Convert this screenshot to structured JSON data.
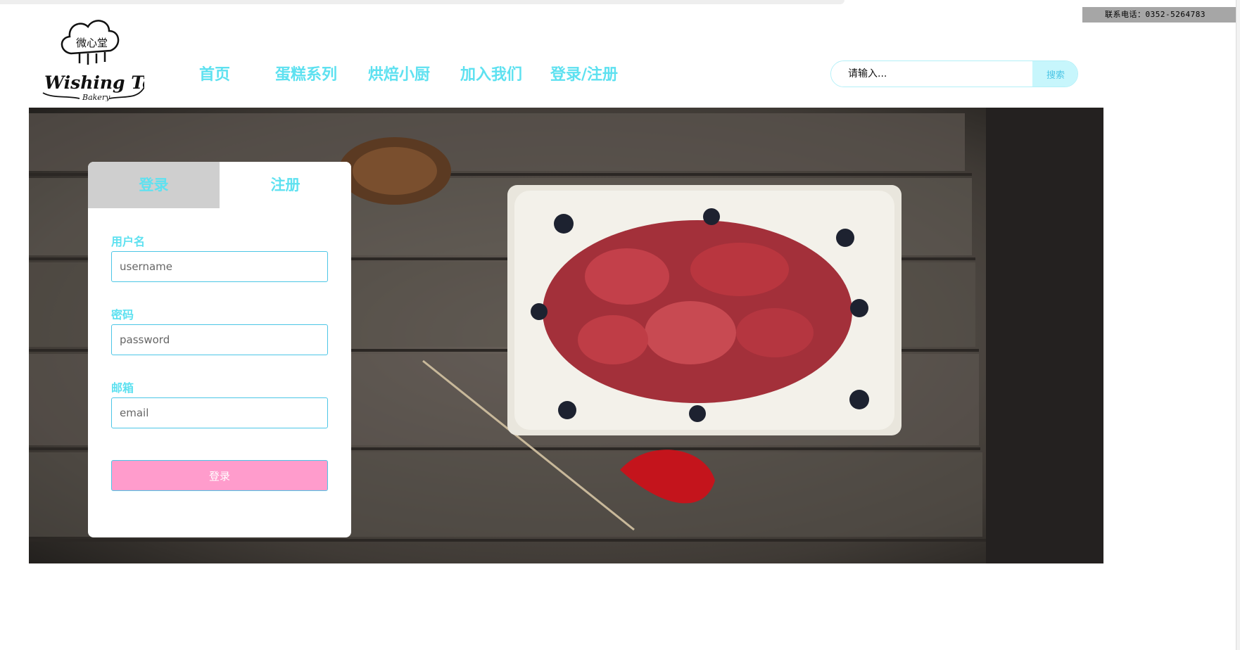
{
  "contact": {
    "label": "联系电话：",
    "phone": "0352-5264783"
  },
  "logo": {
    "chinese_name": "微心堂",
    "name": "Wishing Town",
    "sub": "Bakery"
  },
  "nav": {
    "items": [
      {
        "label": "首页"
      },
      {
        "label": "蛋糕系列"
      },
      {
        "label": "烘焙小厨"
      },
      {
        "label": "加入我们"
      },
      {
        "label": "登录/注册"
      }
    ]
  },
  "search": {
    "placeholder": "请输入...",
    "button": "搜索"
  },
  "form": {
    "tabs": {
      "login": "登录",
      "register": "注册"
    },
    "username_label": "用户名",
    "username_placeholder": "username",
    "password_label": "密码",
    "password_placeholder": "password",
    "email_label": "邮箱",
    "email_placeholder": "email",
    "submit": "登录"
  },
  "colors": {
    "accent": "#5ee1f0",
    "button_pink": "#ff9ccc",
    "tab_inactive": "#cfcfcf",
    "search_button_bg": "#c7f6fc",
    "contact_bg": "#a6a6a6"
  },
  "icons": [
    "bakery-logo-icon",
    "cake-photo-image"
  ]
}
